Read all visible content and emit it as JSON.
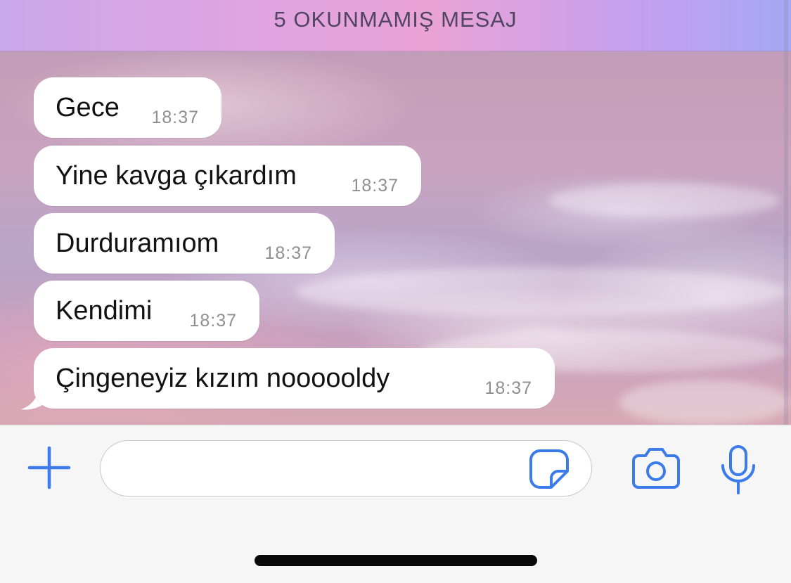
{
  "banner": {
    "unread_text": "5 OKUNMAMIŞ MESAJ"
  },
  "messages": [
    {
      "text": "Gece",
      "time": "18:37"
    },
    {
      "text": "Yine kavga çıkardım",
      "time": "18:37"
    },
    {
      "text": "Durduramıom",
      "time": "18:37"
    },
    {
      "text": "Kendimi",
      "time": "18:37"
    },
    {
      "text": "Çingeneyiz kızım noooooldy",
      "time": "18:37"
    }
  ],
  "composer": {
    "value": "",
    "icons": [
      "plus-icon",
      "sticker-icon",
      "camera-icon",
      "microphone-icon"
    ]
  },
  "colors": {
    "accent": "#3b7bea",
    "bubble": "#ffffff",
    "timestamp": "#8e8e93"
  }
}
